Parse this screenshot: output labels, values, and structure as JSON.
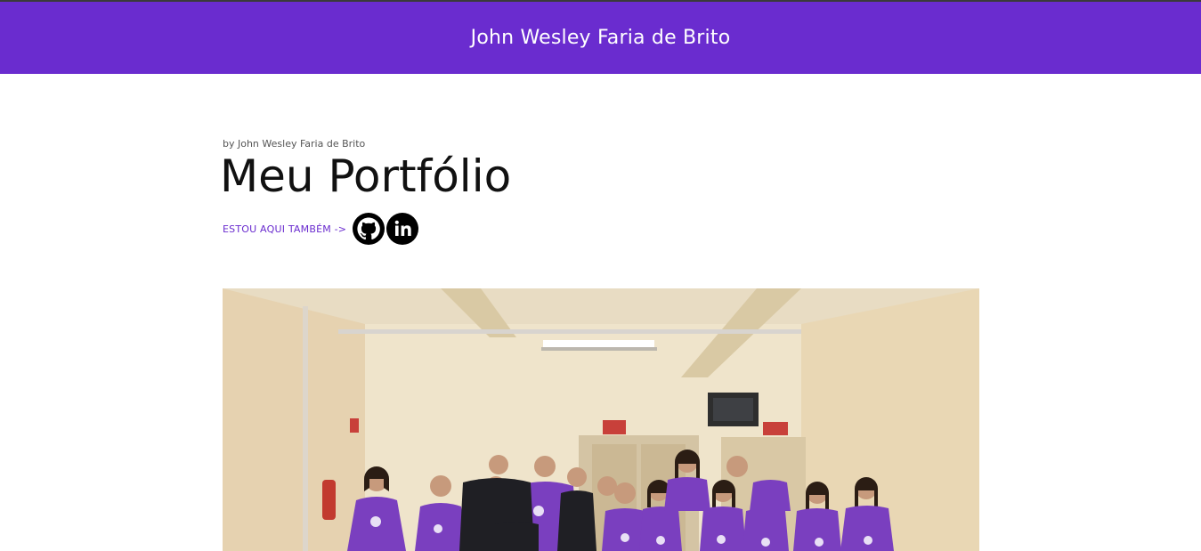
{
  "header": {
    "title": "John Wesley Faria de Brito",
    "background": "#6a2ccf"
  },
  "main": {
    "byline": "by John Wesley Faria de Brito",
    "title": "Meu Portfólio",
    "social_label": "ESTOU AQUI TAMBÉM ->",
    "social_links": [
      {
        "icon": "github-icon"
      },
      {
        "icon": "linkedin-icon"
      }
    ],
    "photo": {
      "description_icon": "group-photo",
      "shirt_color": "#7a3fbf",
      "wall_color": "#efe3c8"
    }
  }
}
